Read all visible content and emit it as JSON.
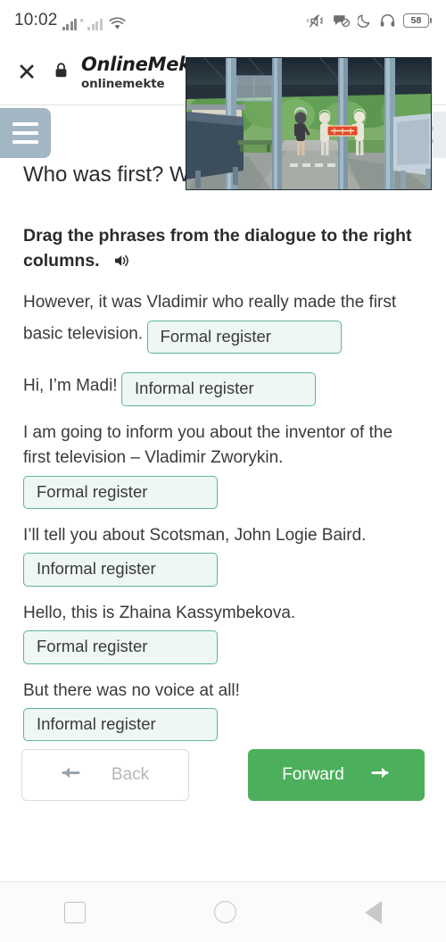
{
  "status_bar": {
    "time": "10:02",
    "battery_level": "58",
    "icons": [
      "signal-bars-icon",
      "signal-bars-no-sim-icon",
      "wifi-icon",
      "volume-mute-icon",
      "dnd-message-icon",
      "night-mode-moon-icon",
      "headphones-icon",
      "battery-icon"
    ]
  },
  "browser_header": {
    "close_label": "✕",
    "lock_icon": "lock-icon",
    "site_title": "OnlineMekt",
    "site_url": "onlinemekte"
  },
  "page": {
    "title": "Who was first? Who was last?",
    "menu_icon": "hamburger-menu-icon",
    "instruction": "Drag the phrases from the dialogue to the right columns.",
    "speaker_icon": "speaker-audio-icon",
    "phrases": [
      {
        "text": "However, it was Vladimir who really made the first basic television.",
        "answer": "Formal register"
      },
      {
        "text": "Hi, I’m Madi!",
        "answer": "Informal register"
      },
      {
        "text": "I am going to inform you about the inventor of the first television – Vladimir Zworykin.",
        "answer": "Formal register"
      },
      {
        "text": "I’ll tell you about Scotsman, John Logie Baird.",
        "answer": "Informal register"
      },
      {
        "text": "Hello, this is Zhaina Kassymbekova.",
        "answer": "Formal register"
      },
      {
        "text": "But there was no voice at all!",
        "answer": "Informal register"
      }
    ]
  },
  "nav_buttons": {
    "back_label": "Back",
    "back_icon": "arrow-left-icon",
    "forward_label": "Forward",
    "forward_icon": "arrow-right-icon"
  },
  "overlay_image": {
    "name": "anime-pavilion-scene-image",
    "description": "Anime style illustration of a covered walkway with students and trees"
  },
  "android_nav": {
    "recents": "recents-square-icon",
    "home": "home-circle-icon",
    "back": "back-triangle-icon"
  },
  "colors": {
    "accent_green": "#4caf5c",
    "dropzone_border": "#5fb3a4",
    "dropzone_fill": "#eef7f3",
    "menu_blue_gray": "#a3b6c4"
  }
}
